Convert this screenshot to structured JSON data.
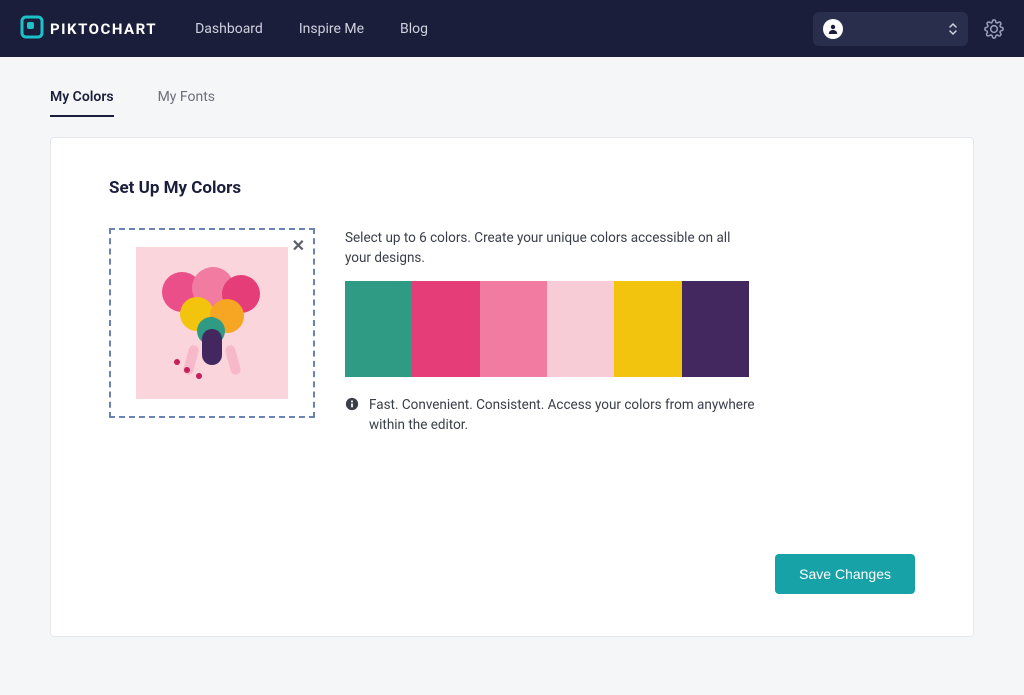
{
  "brand": {
    "name": "PIKTOCHART",
    "accent": "#1bc3c9"
  },
  "nav": {
    "items": [
      "Dashboard",
      "Inspire Me",
      "Blog"
    ]
  },
  "tabs": {
    "items": [
      {
        "label": "My Colors",
        "active": true
      },
      {
        "label": "My Fonts",
        "active": false
      }
    ]
  },
  "panel": {
    "title": "Set Up My Colors",
    "description": "Select up to 6 colors. Create your unique colors accessible on all your designs.",
    "info_text": "Fast. Convenient. Consistent. Access your colors from anywhere within the editor.",
    "save_label": "Save Changes",
    "colors": [
      "#2f9b85",
      "#e43d77",
      "#f27ba1",
      "#f7ccd6",
      "#f3c40e",
      "#43275f"
    ]
  }
}
